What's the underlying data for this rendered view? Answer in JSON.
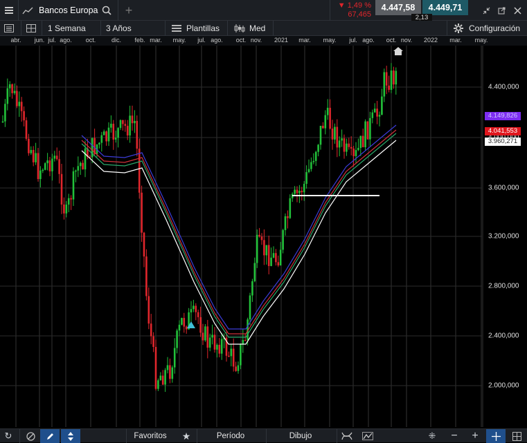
{
  "topbar": {
    "menu_icon": "hamburger-icon",
    "instrument_icon": "line-chart-icon",
    "instrument_name": "Bancos Europa",
    "search_icon": "search-icon",
    "add_tab": "+",
    "change_pct": "▼ 1,49 %",
    "change_points": "67,465",
    "sell_price": "4.447,58",
    "buy_price": "4.449,71",
    "spread": "2,13",
    "window_icons": [
      "shrink-icon",
      "popout-icon",
      "close-icon"
    ]
  },
  "toolbar": {
    "period": "1 Semana",
    "range": "3 Años",
    "templates": "Plantillas",
    "chart_type": "Med",
    "settings": "Configuración"
  },
  "time_axis": [
    "abr.",
    "jun.",
    "jul.",
    "ago.",
    "oct.",
    "dic.",
    "feb.",
    "mar.",
    "may.",
    "jul.",
    "ago.",
    "oct.",
    "nov.",
    "2021",
    "mar.",
    "may.",
    "jul.",
    "ago.",
    "oct.",
    "nov.",
    "2022",
    "mar.",
    "may."
  ],
  "price_axis": [
    "4.400,000",
    "4.000,000",
    "3.600,000",
    "3.200,000",
    "2.800,000",
    "2.400,000",
    "2.000,000"
  ],
  "tags": {
    "purple": "4.149,826",
    "red": "4.041,553",
    "white": "3.960,271"
  },
  "colors": {
    "up": "#22c13a",
    "down": "#e0262c",
    "purple_tag": "#7d2df0",
    "red_tag": "#e0151c",
    "ma_white": "#ffffff",
    "ma_blue": "#3c3cd8",
    "ma_red": "#d0303a",
    "ma_green": "#2aa86a"
  },
  "bottombar": {
    "favorites": "Favoritos",
    "period": "Período",
    "drawing": "Dibujo"
  }
}
